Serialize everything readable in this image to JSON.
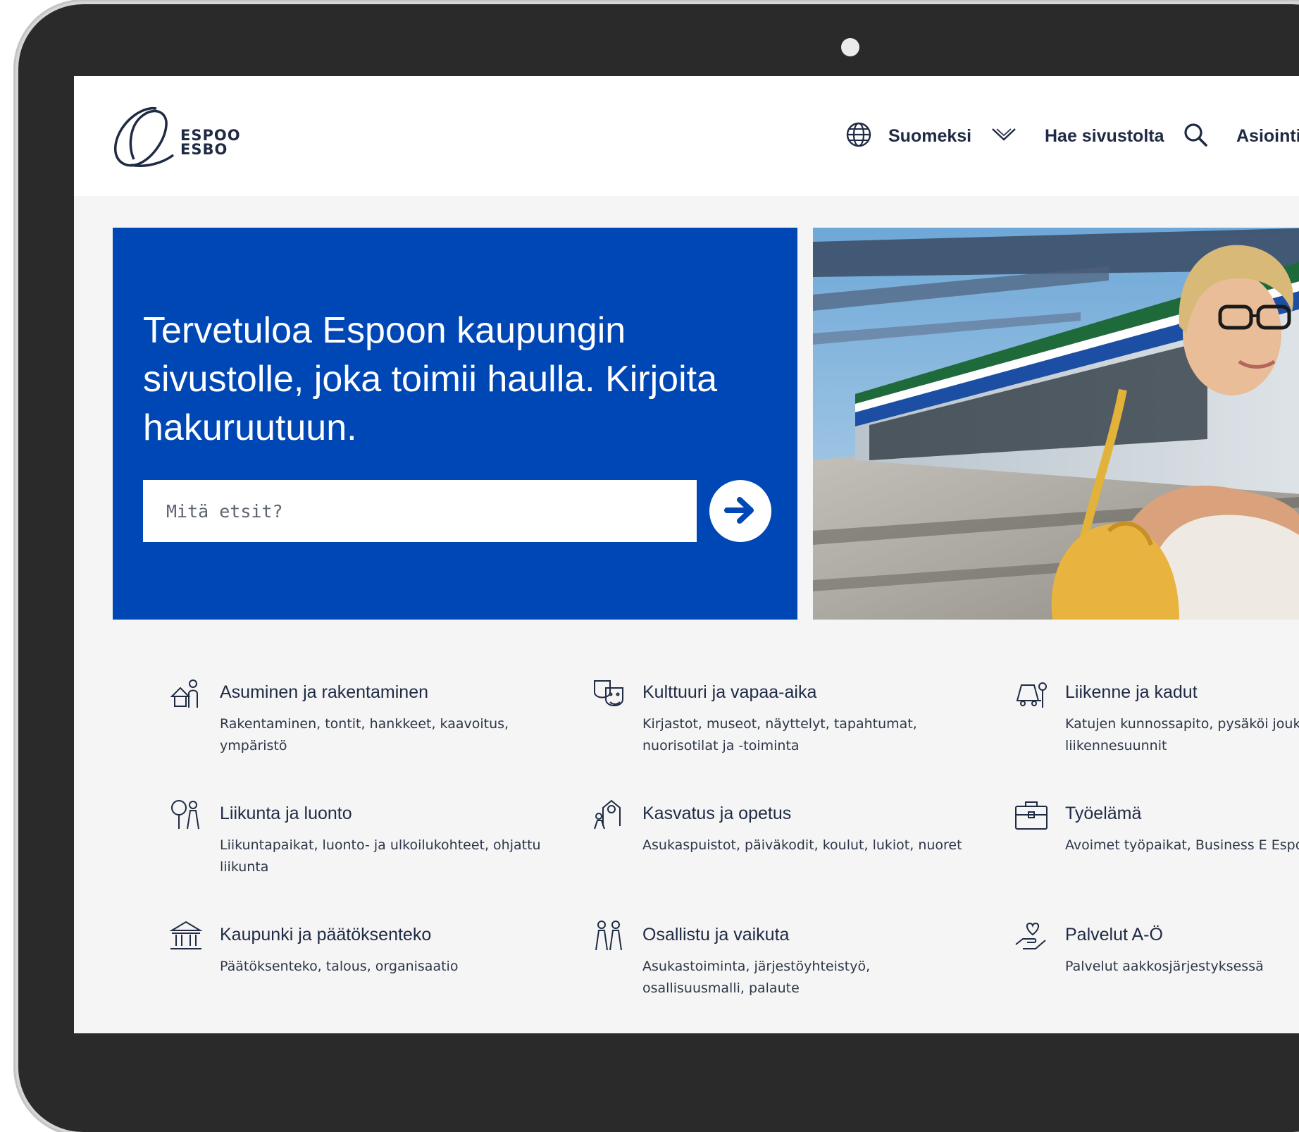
{
  "header": {
    "logo_line1": "ESPOO",
    "logo_line2": "ESBO",
    "language_label": "Suomeksi",
    "search_label": "Hae sivustolta",
    "services_label": "Asiointi"
  },
  "hero": {
    "title": "Tervetuloa Espoon kaupungin sivustolle, joka toimii haulla. Kirjoita hakuruutuun.",
    "search_placeholder": "Mitä etsit?"
  },
  "categories": [
    {
      "title": "Asuminen ja rakentaminen",
      "desc": "Rakentaminen, tontit, hankkeet, kaavoitus, ympäristö",
      "icon": "house-person-icon"
    },
    {
      "title": "Kulttuuri ja vapaa-aika",
      "desc": "Kirjastot, museot, näyttelyt, tapahtumat, nuorisotilat ja -toiminta",
      "icon": "theater-masks-icon"
    },
    {
      "title": "Liikenne ja kadut",
      "desc": "Katujen kunnossapito, pysäköi joukkoliikenne, liikennesuunnit",
      "icon": "traffic-icon"
    },
    {
      "title": "Liikunta ja luonto",
      "desc": "Liikuntapaikat, luonto- ja ulkoilukohteet, ohjattu liikunta",
      "icon": "tree-people-icon"
    },
    {
      "title": "Kasvatus ja opetus",
      "desc": "Asukaspuistot, päiväkodit, koulut, lukiot, nuoret",
      "icon": "school-icon"
    },
    {
      "title": "Työelämä",
      "desc": "Avoimet työpaikat, Business E Espoo",
      "icon": "briefcase-icon"
    },
    {
      "title": "Kaupunki ja päätöksenteko",
      "desc": "Päätöksenteko, talous, organisaatio",
      "icon": "city-hall-icon"
    },
    {
      "title": "Osallistu ja vaikuta",
      "desc": "Asukastoiminta, järjestöyhteistyö, osallisuusmalli, palaute",
      "icon": "people-group-icon"
    },
    {
      "title": "Palvelut A-Ö",
      "desc": "Palvelut aakkosjärjestyksessä",
      "icon": "heart-hand-icon"
    }
  ],
  "colors": {
    "hero_blue": "#0047b6",
    "text_dark": "#1f2a44",
    "frame": "#2a2a2a"
  }
}
